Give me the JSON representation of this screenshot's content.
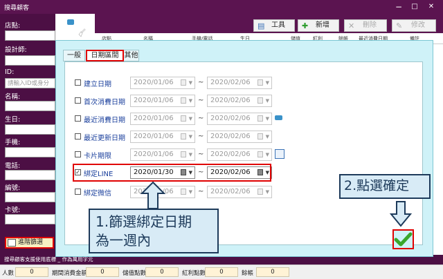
{
  "window": {
    "title": "搜尋顧客",
    "controls": {
      "minimize": "−",
      "maximize": "□",
      "close": "✕"
    }
  },
  "sidebar": {
    "store_label": "店點:",
    "designer_label": "設計師:",
    "id_label": "ID:",
    "id_placeholder": "請輸入ID或身分",
    "name_label": "名稱:",
    "birthday_label": "生日:",
    "mobile_label": "手機:",
    "phone_label": "電話:",
    "number_label": "編號:",
    "card_label": "卡號:",
    "advanced_filter_button": "進階篩選"
  },
  "toolbar": {
    "tools_label": "工具",
    "add_label": "新增",
    "delete_label": "刪除",
    "edit_label": "修改"
  },
  "grid": {
    "headers": [
      "店點",
      "名稱",
      "手機/電話",
      "生日",
      "儲值",
      "紅利",
      "餘帳",
      "最近消費日期",
      "備註"
    ]
  },
  "status_text": "搜尋顧客支援使用底標 _ 作為萬用字元",
  "bottom": {
    "people_label": "人數",
    "people_value": "0",
    "spend_label": "期間消費金額",
    "spend_value": "0",
    "stored_label": "儲值點數",
    "stored_value": "0",
    "bonus_label": "紅利點數",
    "bonus_value": "0",
    "balance_label": "餘帳",
    "balance_value": "0"
  },
  "dialog": {
    "tabs": [
      "一般",
      "日期區間",
      "其他"
    ],
    "active_tab": "日期區間",
    "tilde": "~",
    "rows": [
      {
        "label": "建立日期",
        "checked": false,
        "from": "2020/01/06",
        "to": "2020/02/06"
      },
      {
        "label": "首次消費日期",
        "checked": false,
        "from": "2020/01/06",
        "to": "2020/02/06"
      },
      {
        "label": "最近消費日期",
        "checked": false,
        "from": "2020/01/06",
        "to": "2020/02/06"
      },
      {
        "label": "最近更新日期",
        "checked": false,
        "from": "2020/01/06",
        "to": "2020/02/06"
      },
      {
        "label": "卡片期限",
        "checked": false,
        "from": "2020/01/06",
        "to": "2020/02/06"
      },
      {
        "label": "綁定LINE",
        "checked": true,
        "from": "2020/01/30",
        "to": "2020/02/06"
      },
      {
        "label": "綁定微信",
        "checked": false,
        "from": "2020/01/06",
        "to": "2020/02/06"
      }
    ]
  },
  "annotations": {
    "callout1_line1": "1.篩選綁定日期",
    "callout1_line2": "為一週內",
    "callout2": "2.點選確定"
  },
  "colors": {
    "brand_purple": "#4c0f44",
    "highlight_red": "#e00000",
    "dialog_bg": "#cff2f8",
    "callout_bg": "#d8ebf6",
    "ok_green": "#3aa62b"
  }
}
